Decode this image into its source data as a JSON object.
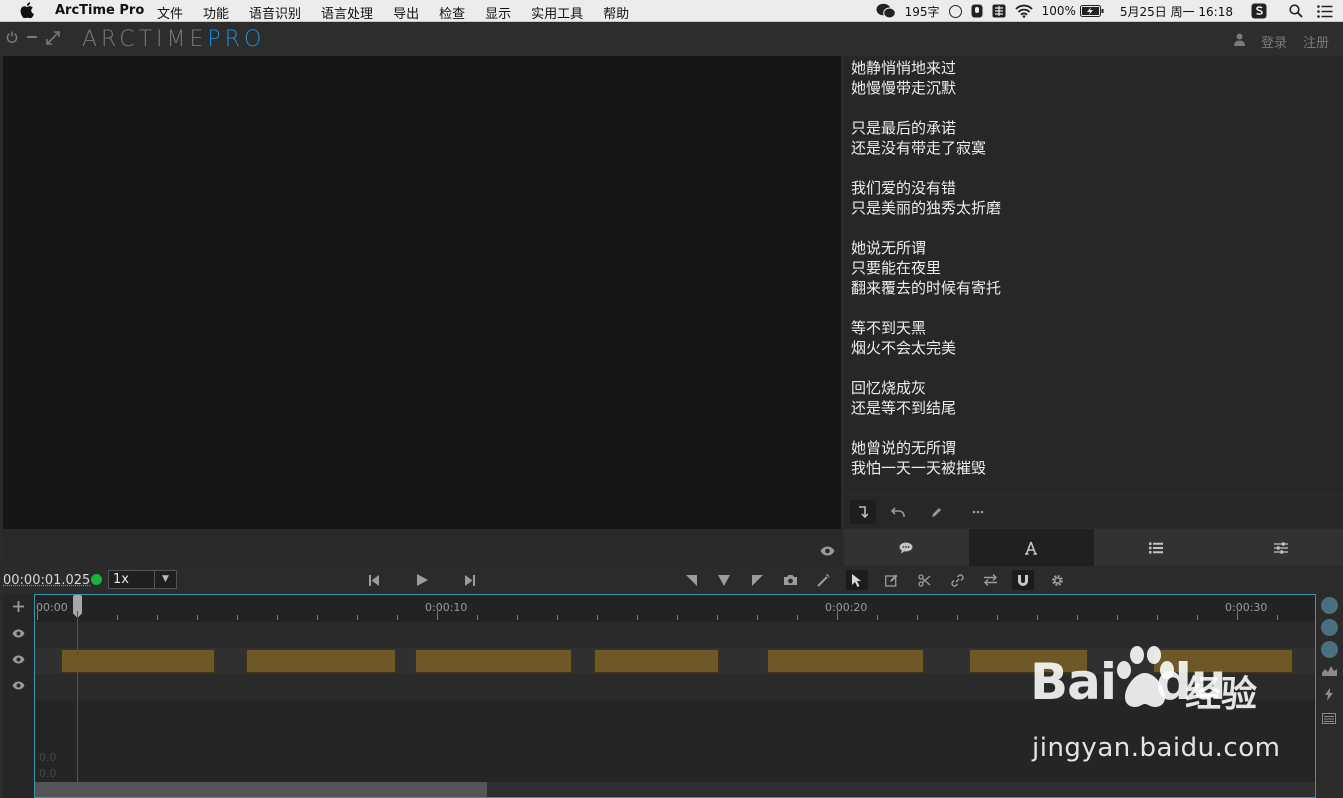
{
  "menubar": {
    "app_name": "ArcTime Pro",
    "menus": [
      "文件",
      "功能",
      "语音识别",
      "语言处理",
      "导出",
      "检查",
      "显示",
      "实用工具",
      "帮助"
    ],
    "status": {
      "wordcount": "195字",
      "battery": "100%",
      "datetime": "5月25日 周一  16:18"
    }
  },
  "titlebar": {
    "logo_main": "ARCTIME",
    "logo_accent": "PRO",
    "login": "登录",
    "register": "注册"
  },
  "subtitles": {
    "text": "她静悄悄地来过\n她慢慢带走沉默\n\n只是最后的承诺\n还是没有带走了寂寞\n\n我们爱的没有错\n只是美丽的独秀太折磨\n\n她说无所谓\n只要能在夜里\n翻来覆去的时候有寄托\n\n等不到天黑\n烟火不会太完美\n\n回忆烧成灰\n还是等不到结尾\n\n她曾说的无所谓\n我怕一天一天被摧毁"
  },
  "controls": {
    "timecode": "00:00:01.025",
    "speed": "1x"
  },
  "timeline": {
    "labels": [
      "00:00",
      "0:00:10",
      "0:00:20",
      "0:00:30"
    ],
    "ghost_line1": "0.0",
    "ghost_line2": "0.0",
    "clip_count": 7
  },
  "watermark": {
    "brand": "Bai",
    "brand2": "du",
    "name": "经验",
    "url": "jingyan.baidu.com"
  },
  "colors": {
    "accent": "#1b8fd8",
    "clip": "#6f5828",
    "playhead": "#d41d1d",
    "status_dot": "#17b33a"
  }
}
